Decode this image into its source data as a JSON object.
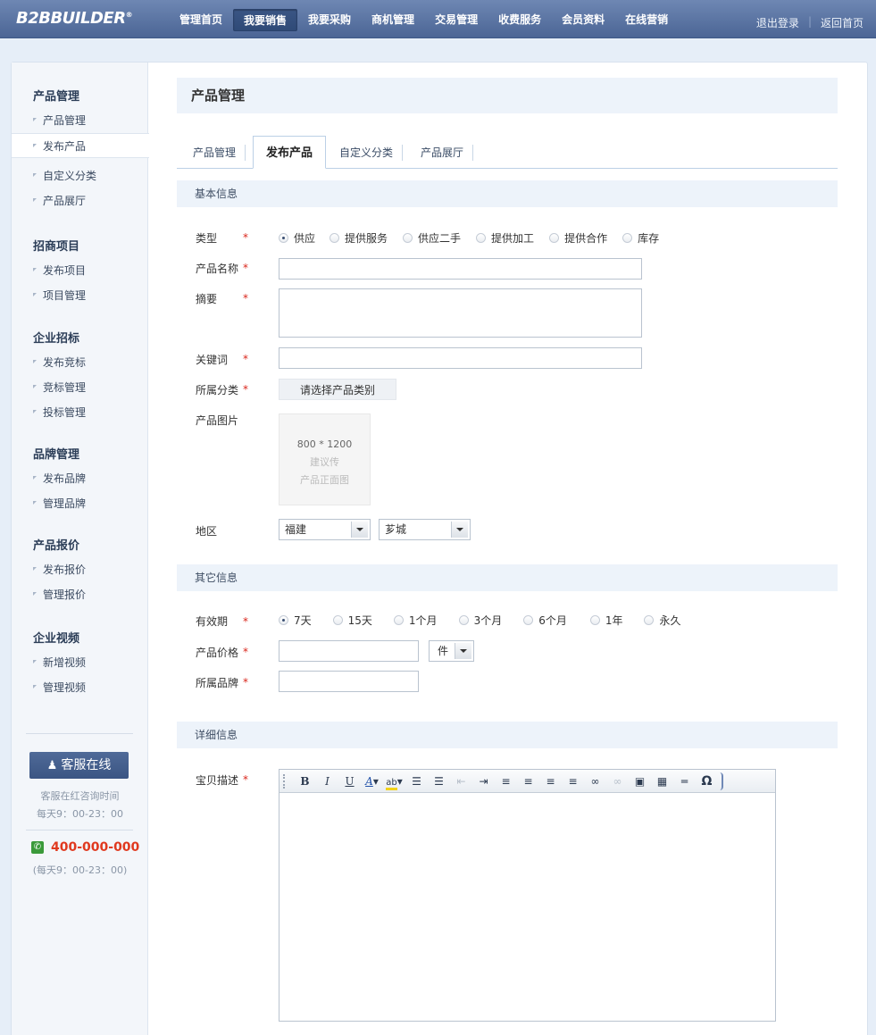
{
  "brand": {
    "logo_text": "B2BBUILDER",
    "logo_mark": "®"
  },
  "nav": {
    "items": [
      "管理首页",
      "我要销售",
      "我要采购",
      "商机管理",
      "交易管理",
      "收费服务",
      "会员资料",
      "在线营销"
    ],
    "active_index": 1
  },
  "top_links": {
    "logout": "退出登录",
    "separator": "|",
    "home": "返回首页"
  },
  "sidebar": {
    "groups": [
      {
        "title": "产品管理",
        "items": [
          "产品管理",
          "发布产品",
          "自定义分类",
          "产品展厅"
        ]
      },
      {
        "title": "招商项目",
        "items": [
          "发布项目",
          "项目管理"
        ]
      },
      {
        "title": "企业招标",
        "items": [
          "发布竞标",
          "竞标管理",
          "投标管理"
        ]
      },
      {
        "title": "品牌管理",
        "items": [
          "发布品牌",
          "管理品牌"
        ]
      },
      {
        "title": "产品报价",
        "items": [
          "发布报价",
          "管理报价"
        ]
      },
      {
        "title": "企业视频",
        "items": [
          "新增视频",
          "管理视频"
        ]
      }
    ],
    "active_item": "发布产品",
    "service": {
      "button": "客服在线",
      "note_line1": "客服在红咨询时间",
      "note_line2": "每天9：00-23：00",
      "phone": "400-000-000",
      "phone_hours": "(每天9：00-23：00)"
    }
  },
  "page": {
    "title": "产品管理"
  },
  "tabs": {
    "items": [
      "产品管理",
      "发布产品",
      "自定义分类",
      "产品展厅"
    ],
    "active_index": 1
  },
  "basic": {
    "section_title": "基本信息",
    "type_label": "类型",
    "type_options": [
      "供应",
      "提供服务",
      "供应二手",
      "提供加工",
      "提供合作",
      "库存"
    ],
    "type_selected": "供应",
    "name_label": "产品名称",
    "name_value": "",
    "summary_label": "摘要",
    "summary_value": "",
    "keywords_label": "关键词",
    "keywords_value": "",
    "category_label": "所属分类",
    "category_button": "请选择产品类别",
    "image_label": "产品图片",
    "image_dim": "800 * 1200",
    "image_hint1": "建议传",
    "image_hint2": "产品正面图",
    "region_label": "地区",
    "region_province": "福建",
    "region_city": "芗城",
    "required_mark": "*"
  },
  "other": {
    "section_title": "其它信息",
    "validity_label": "有效期",
    "validity_options": [
      "7天",
      "15天",
      "1个月",
      "3个月",
      "6个月",
      "1年",
      "永久"
    ],
    "validity_selected": "7天",
    "price_label": "产品价格",
    "price_value": "",
    "unit_value": "件",
    "brand_label": "所属品牌",
    "brand_value": ""
  },
  "detail": {
    "section_title": "详细信息",
    "desc_label": "宝贝描述",
    "toolbar": {
      "bold": "B",
      "italic": "I",
      "underline": "U",
      "font_color": "A",
      "highlight": "ab",
      "special_char": "Ω"
    }
  },
  "colors": {
    "nav_bg": "#4b6595",
    "accent_red": "#d9261c",
    "phone_red": "#e0391f",
    "section_bg": "#edf3fa"
  }
}
